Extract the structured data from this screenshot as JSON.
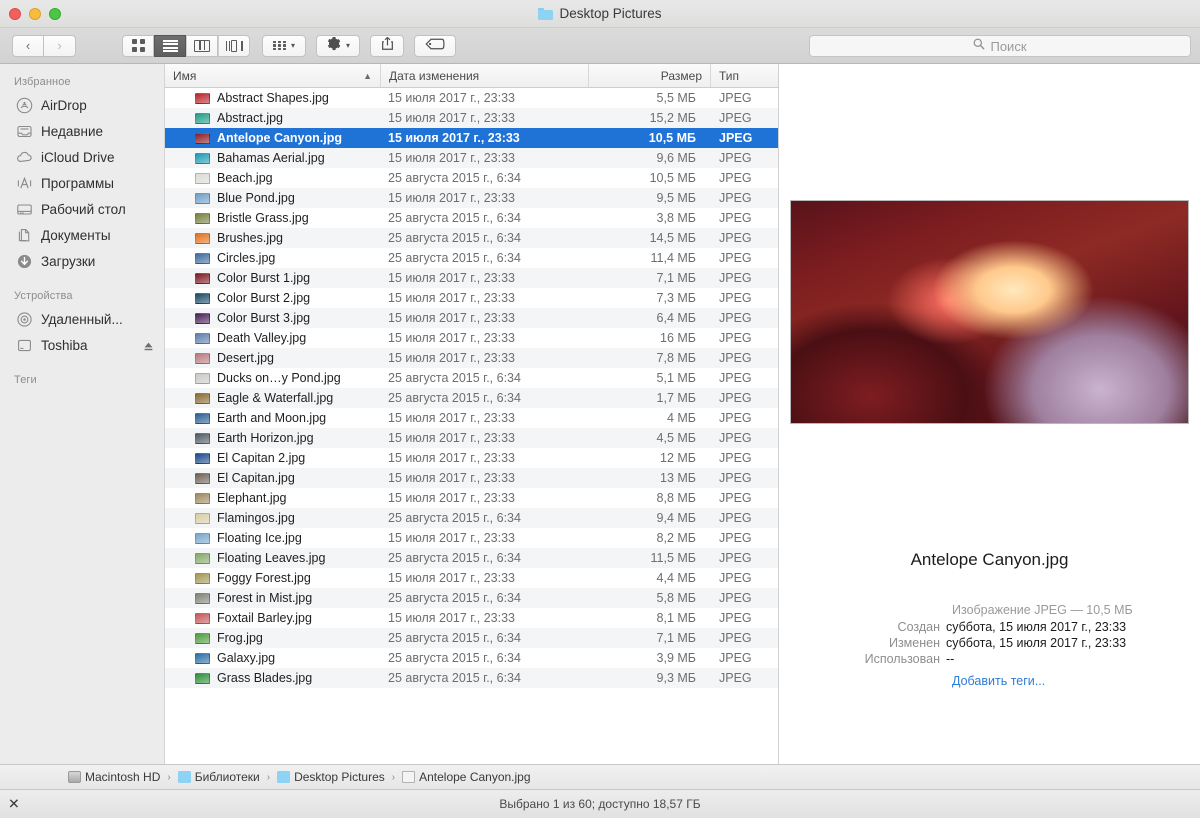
{
  "window": {
    "title": "Desktop Pictures",
    "folder_icon": "folder-icon",
    "traffic_lights": [
      "close",
      "minimize",
      "zoom"
    ]
  },
  "toolbar": {
    "back_label": "‹",
    "forward_label": "›",
    "view_buttons": [
      {
        "name": "icon-view",
        "active": false
      },
      {
        "name": "list-view",
        "active": true
      },
      {
        "name": "column-view",
        "active": false
      },
      {
        "name": "gallery-view",
        "active": false
      }
    ],
    "arrange_label": "arrange-icon",
    "action_label": "gear-icon",
    "share_label": "share-icon",
    "tag_label": "tag-icon",
    "caret": "▾"
  },
  "search": {
    "placeholder": "Поиск",
    "icon": "search-icon",
    "value": ""
  },
  "sidebar": {
    "sections": [
      {
        "header": "Избранное",
        "items": [
          {
            "label": "AirDrop",
            "icon": "airdrop-icon"
          },
          {
            "label": "Недавние",
            "icon": "recents-icon"
          },
          {
            "label": "iCloud Drive",
            "icon": "cloud-icon"
          },
          {
            "label": "Программы",
            "icon": "applications-icon"
          },
          {
            "label": "Рабочий стол",
            "icon": "desktop-icon"
          },
          {
            "label": "Документы",
            "icon": "documents-icon"
          },
          {
            "label": "Загрузки",
            "icon": "downloads-icon"
          }
        ]
      },
      {
        "header": "Устройства",
        "items": [
          {
            "label": "Удаленный...",
            "icon": "disc-icon"
          },
          {
            "label": "Toshiba",
            "icon": "harddisk-icon",
            "eject": true
          }
        ]
      },
      {
        "header": "Теги",
        "items": []
      }
    ]
  },
  "filelist": {
    "columns": [
      {
        "key": "name",
        "label": "Имя",
        "sorted": true,
        "sort_dir": "asc"
      },
      {
        "key": "date",
        "label": "Дата изменения"
      },
      {
        "key": "size",
        "label": "Размер"
      },
      {
        "key": "kind",
        "label": "Тип"
      }
    ],
    "selected_index": 2,
    "rows": [
      {
        "name": "Abstract Shapes.jpg",
        "date": "15 июля 2017 г., 23:33",
        "size": "5,5 МБ",
        "kind": "JPEG",
        "thumb": "#b8262a"
      },
      {
        "name": "Abstract.jpg",
        "date": "15 июля 2017 г., 23:33",
        "size": "15,2 МБ",
        "kind": "JPEG",
        "thumb": "#1f9e86"
      },
      {
        "name": "Antelope Canyon.jpg",
        "date": "15 июля 2017 г., 23:33",
        "size": "10,5 МБ",
        "kind": "JPEG",
        "thumb": "#8d1c22"
      },
      {
        "name": "Bahamas Aerial.jpg",
        "date": "15 июля 2017 г., 23:33",
        "size": "9,6 МБ",
        "kind": "JPEG",
        "thumb": "#1b9bb5"
      },
      {
        "name": "Beach.jpg",
        "date": "25 августа 2015 г., 6:34",
        "size": "10,5 МБ",
        "kind": "JPEG",
        "thumb": "#dcdcd4"
      },
      {
        "name": "Blue Pond.jpg",
        "date": "15 июля 2017 г., 23:33",
        "size": "9,5 МБ",
        "kind": "JPEG",
        "thumb": "#6e9ec6"
      },
      {
        "name": "Bristle Grass.jpg",
        "date": "25 августа 2015 г., 6:34",
        "size": "3,8 МБ",
        "kind": "JPEG",
        "thumb": "#77803f"
      },
      {
        "name": "Brushes.jpg",
        "date": "25 августа 2015 г., 6:34",
        "size": "14,5 МБ",
        "kind": "JPEG",
        "thumb": "#e2711d"
      },
      {
        "name": "Circles.jpg",
        "date": "25 августа 2015 г., 6:34",
        "size": "11,4 МБ",
        "kind": "JPEG",
        "thumb": "#3f6c9e"
      },
      {
        "name": "Color Burst 1.jpg",
        "date": "15 июля 2017 г., 23:33",
        "size": "7,1 МБ",
        "kind": "JPEG",
        "thumb": "#7d1b22"
      },
      {
        "name": "Color Burst 2.jpg",
        "date": "15 июля 2017 г., 23:33",
        "size": "7,3 МБ",
        "kind": "JPEG",
        "thumb": "#1c4b66"
      },
      {
        "name": "Color Burst 3.jpg",
        "date": "15 июля 2017 г., 23:33",
        "size": "6,4 МБ",
        "kind": "JPEG",
        "thumb": "#4a2254"
      },
      {
        "name": "Death Valley.jpg",
        "date": "15 июля 2017 г., 23:33",
        "size": "16 МБ",
        "kind": "JPEG",
        "thumb": "#5d7fae"
      },
      {
        "name": "Desert.jpg",
        "date": "15 июля 2017 г., 23:33",
        "size": "7,8 МБ",
        "kind": "JPEG",
        "thumb": "#b87a80"
      },
      {
        "name": "Ducks on…y Pond.jpg",
        "date": "25 августа 2015 г., 6:34",
        "size": "5,1 МБ",
        "kind": "JPEG",
        "thumb": "#c9cbc6"
      },
      {
        "name": "Eagle & Waterfall.jpg",
        "date": "25 августа 2015 г., 6:34",
        "size": "1,7 МБ",
        "kind": "JPEG",
        "thumb": "#8a6a33"
      },
      {
        "name": "Earth and Moon.jpg",
        "date": "15 июля 2017 г., 23:33",
        "size": "4 МБ",
        "kind": "JPEG",
        "thumb": "#2a5f96"
      },
      {
        "name": "Earth Horizon.jpg",
        "date": "15 июля 2017 г., 23:33",
        "size": "4,5 МБ",
        "kind": "JPEG",
        "thumb": "#4f5a62"
      },
      {
        "name": "El Capitan 2.jpg",
        "date": "15 июля 2017 г., 23:33",
        "size": "12 МБ",
        "kind": "JPEG",
        "thumb": "#1d4a8c"
      },
      {
        "name": "El Capitan.jpg",
        "date": "15 июля 2017 г., 23:33",
        "size": "13 МБ",
        "kind": "JPEG",
        "thumb": "#6e6257"
      },
      {
        "name": "Elephant.jpg",
        "date": "15 июля 2017 г., 23:33",
        "size": "8,8 МБ",
        "kind": "JPEG",
        "thumb": "#a08a5e"
      },
      {
        "name": "Flamingos.jpg",
        "date": "25 августа 2015 г., 6:34",
        "size": "9,4 МБ",
        "kind": "JPEG",
        "thumb": "#d8cda4"
      },
      {
        "name": "Floating Ice.jpg",
        "date": "15 июля 2017 г., 23:33",
        "size": "8,2 МБ",
        "kind": "JPEG",
        "thumb": "#79a6c9"
      },
      {
        "name": "Floating Leaves.jpg",
        "date": "25 августа 2015 г., 6:34",
        "size": "11,5 МБ",
        "kind": "JPEG",
        "thumb": "#85a86a"
      },
      {
        "name": "Foggy Forest.jpg",
        "date": "15 июля 2017 г., 23:33",
        "size": "4,4 МБ",
        "kind": "JPEG",
        "thumb": "#a39857"
      },
      {
        "name": "Forest in Mist.jpg",
        "date": "25 августа 2015 г., 6:34",
        "size": "5,8 МБ",
        "kind": "JPEG",
        "thumb": "#7f8478"
      },
      {
        "name": "Foxtail Barley.jpg",
        "date": "15 июля 2017 г., 23:33",
        "size": "8,1 МБ",
        "kind": "JPEG",
        "thumb": "#c4575b"
      },
      {
        "name": "Frog.jpg",
        "date": "25 августа 2015 г., 6:34",
        "size": "7,1 МБ",
        "kind": "JPEG",
        "thumb": "#4f9b3c"
      },
      {
        "name": "Galaxy.jpg",
        "date": "25 августа 2015 г., 6:34",
        "size": "3,9 МБ",
        "kind": "JPEG",
        "thumb": "#2b6ea8"
      },
      {
        "name": "Grass Blades.jpg",
        "date": "25 августа 2015 г., 6:34",
        "size": "9,3 МБ",
        "kind": "JPEG",
        "thumb": "#2f8e3a"
      }
    ]
  },
  "preview": {
    "image_alt": "Antelope Canyon preview",
    "filename": "Antelope Canyon.jpg",
    "kind_line": "Изображение JPEG — 10,5 МБ",
    "fields": [
      {
        "label": "Создан",
        "value": "суббота, 15 июля 2017 г., 23:33"
      },
      {
        "label": "Изменен",
        "value": "суббота, 15 июля 2017 г., 23:33"
      },
      {
        "label": "Использован",
        "value": "--"
      }
    ],
    "add_tags": "Добавить теги..."
  },
  "pathbar": {
    "crumbs": [
      {
        "label": "Macintosh HD",
        "icon": "harddisk-icon"
      },
      {
        "label": "Библиотеки",
        "icon": "folder-icon"
      },
      {
        "label": "Desktop Pictures",
        "icon": "folder-icon"
      },
      {
        "label": "Antelope Canyon.jpg",
        "icon": "file-icon"
      }
    ],
    "separator": "›"
  },
  "statusbar": {
    "text": "Выбрано 1 из 60; доступно 18,57 ГБ",
    "left_icon": "✕"
  },
  "colors": {
    "selection_blue": "#1f72d6",
    "link_blue": "#2f7bd6",
    "sidebar_bg": "#ececec",
    "stripe": "#f4f5f7"
  }
}
